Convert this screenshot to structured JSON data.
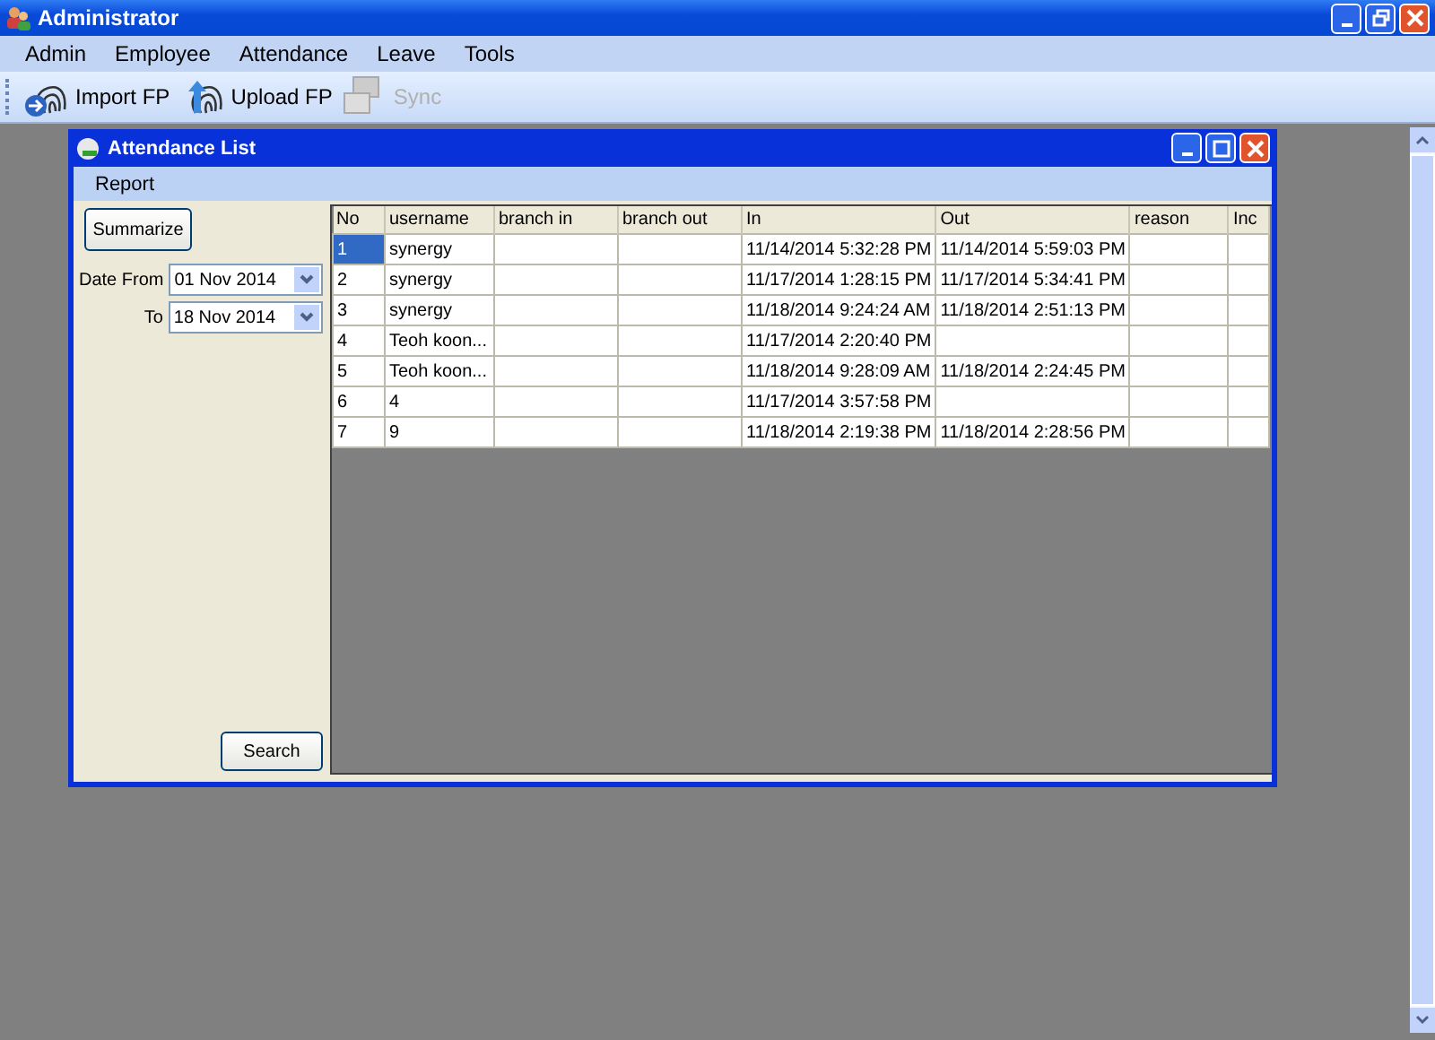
{
  "window": {
    "title": "Administrator"
  },
  "menu": [
    "Admin",
    "Employee",
    "Attendance",
    "Leave",
    "Tools"
  ],
  "toolbar": [
    {
      "label": "Import FP",
      "kind": "import",
      "disabled": false
    },
    {
      "label": "Upload FP",
      "kind": "upload",
      "disabled": false
    },
    {
      "label": "Sync",
      "kind": "sync",
      "disabled": true
    }
  ],
  "child_window": {
    "title": "Attendance List",
    "menu": [
      "Report"
    ],
    "summarize_button": "Summarize",
    "date_from": {
      "label": "Date From",
      "value": "01 Nov 2014"
    },
    "date_to": {
      "label": "To",
      "value": "18 Nov 2014"
    },
    "search_button": "Search",
    "table": {
      "columns": [
        "No",
        "username",
        "branch in",
        "branch out",
        "In",
        "Out",
        "reason",
        "Inc"
      ],
      "rows": [
        {
          "selected": true,
          "cells": [
            "1",
            "synergy",
            "",
            "",
            "11/14/2014 5:32:28 PM",
            "11/14/2014 5:59:03 PM",
            "",
            ""
          ]
        },
        {
          "selected": false,
          "cells": [
            "2",
            "synergy",
            "",
            "",
            "11/17/2014 1:28:15 PM",
            "11/17/2014 5:34:41 PM",
            "",
            ""
          ]
        },
        {
          "selected": false,
          "cells": [
            "3",
            "synergy",
            "",
            "",
            "11/18/2014 9:24:24 AM",
            "11/18/2014 2:51:13 PM",
            "",
            ""
          ]
        },
        {
          "selected": false,
          "cells": [
            "4",
            "Teoh koon...",
            "",
            "",
            "11/17/2014 2:20:40 PM",
            "",
            "",
            ""
          ]
        },
        {
          "selected": false,
          "cells": [
            "5",
            "Teoh koon...",
            "",
            "",
            "11/18/2014 9:28:09 AM",
            "11/18/2014 2:24:45 PM",
            "",
            ""
          ]
        },
        {
          "selected": false,
          "cells": [
            "6",
            "4",
            "",
            "",
            "11/17/2014 3:57:58 PM",
            "",
            "",
            ""
          ]
        },
        {
          "selected": false,
          "cells": [
            "7",
            "9",
            "",
            "",
            "11/18/2014 2:19:38 PM",
            "11/18/2014 2:28:56 PM",
            "",
            ""
          ]
        }
      ]
    }
  }
}
